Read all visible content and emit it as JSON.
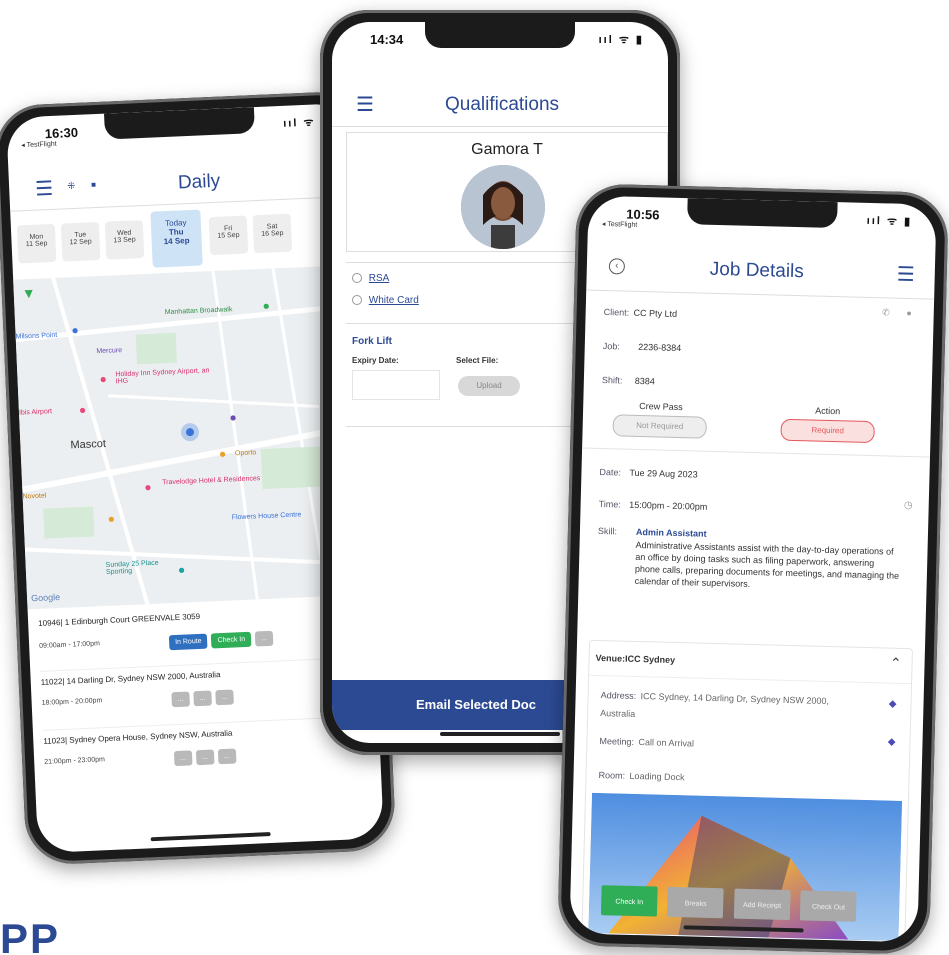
{
  "phone1": {
    "time": "16:30",
    "back_label": "◂ TestFlight",
    "status_icons": "ııl ᯤ ▮",
    "title": "Daily",
    "icon_a": "⁜",
    "icon_b": "■",
    "days": [
      {
        "d": "Mon",
        "n": "11 Sep"
      },
      {
        "d": "Tue",
        "n": "12 Sep"
      },
      {
        "d": "Wed",
        "n": "13 Sep"
      },
      {
        "d": "Thu",
        "n": "14 Sep",
        "today": "Today"
      },
      {
        "d": "Fri",
        "n": "15 Sep"
      },
      {
        "d": "Sat",
        "n": "16 Sep"
      }
    ],
    "map_labels": {
      "l1": "Manhattan Broadwalk",
      "l2": "Holiday Inn Sydney Airport, an IHG",
      "l3": "Mascot",
      "l4": "Mercure",
      "l5": "Ibis Airport",
      "l6": "Novotel",
      "l7": "Travelodge Hotel & Residences",
      "l8": "Sunday 25 Place Sporting",
      "l9": "Flowers House Centre",
      "l10": "Oporto",
      "l11": "Milsons Point",
      "google": "Google"
    },
    "jobs": [
      {
        "title": "10946| 1 Edinburgh Court GREENVALE 3059",
        "time": "09:00am - 17:00pm",
        "b1": "In Route",
        "b2": "Check In",
        "b3": "..."
      },
      {
        "title": "11022| 14 Darling Dr, Sydney NSW 2000, Australia",
        "time": "18:00pm - 20:00pm",
        "b1": "...",
        "b2": "...",
        "b3": "..."
      },
      {
        "title": "11023| Sydney Opera House, Sydney NSW, Australia",
        "time": "21:00pm - 23:00pm",
        "b1": "...",
        "b2": "...",
        "b3": "..."
      }
    ]
  },
  "phone2": {
    "time": "14:34",
    "status_icons": "ııl ᯤ ▮",
    "title": "Qualifications",
    "name": "Gamora T",
    "checks": [
      "RSA",
      "White Card"
    ],
    "section": "Fork Lift",
    "expiry_label": "Expiry Date:",
    "select_label": "Select File:",
    "upload": "Upload",
    "email_button": "Email Selected Doc"
  },
  "phone3": {
    "time": "10:56",
    "back_label": "◂ TestFlight",
    "status_icons": "ııl ᯤ ▮",
    "title": "Job Details",
    "client_label": "Client:",
    "client": "CC Pty Ltd",
    "job_label": "Job:",
    "job": "2236-8384",
    "shift_label": "Shift:",
    "shift": "8384",
    "crew_pass_label": "Crew Pass",
    "crew_pass_btn": "Not Required",
    "action_label": "Action",
    "action_btn": "Required",
    "date_label": "Date:",
    "date": "Tue 29 Aug 2023",
    "time_label": "Time:",
    "time_range": "15:00pm - 20:00pm",
    "skill_label": "Skill:",
    "skill_title": "Admin Assistant",
    "skill_desc": "Administrative Assistants assist with the day-to-day operations of an office by doing tasks such as filing paperwork, answering phone calls, preparing documents for meetings, and managing the calendar of their supervisors.",
    "venue_label": "Venue:ICC Sydney",
    "address_label": "Address:",
    "address": "ICC Sydney, 14 Darling Dr, Sydney NSW 2000, Australia",
    "meeting_label": "Meeting:",
    "meeting": "Call on Arrival",
    "room_label": "Room:",
    "room": "Loading Dock",
    "actions": [
      "Check In",
      "Breaks",
      "Add Receipt",
      "Check Out"
    ]
  },
  "brand": "PP",
  "colors": {
    "accent": "#2c4a93",
    "green": "#2fae57",
    "blue": "#2f6fbf",
    "red": "#e4575b",
    "grey": "#b9b9b9"
  }
}
